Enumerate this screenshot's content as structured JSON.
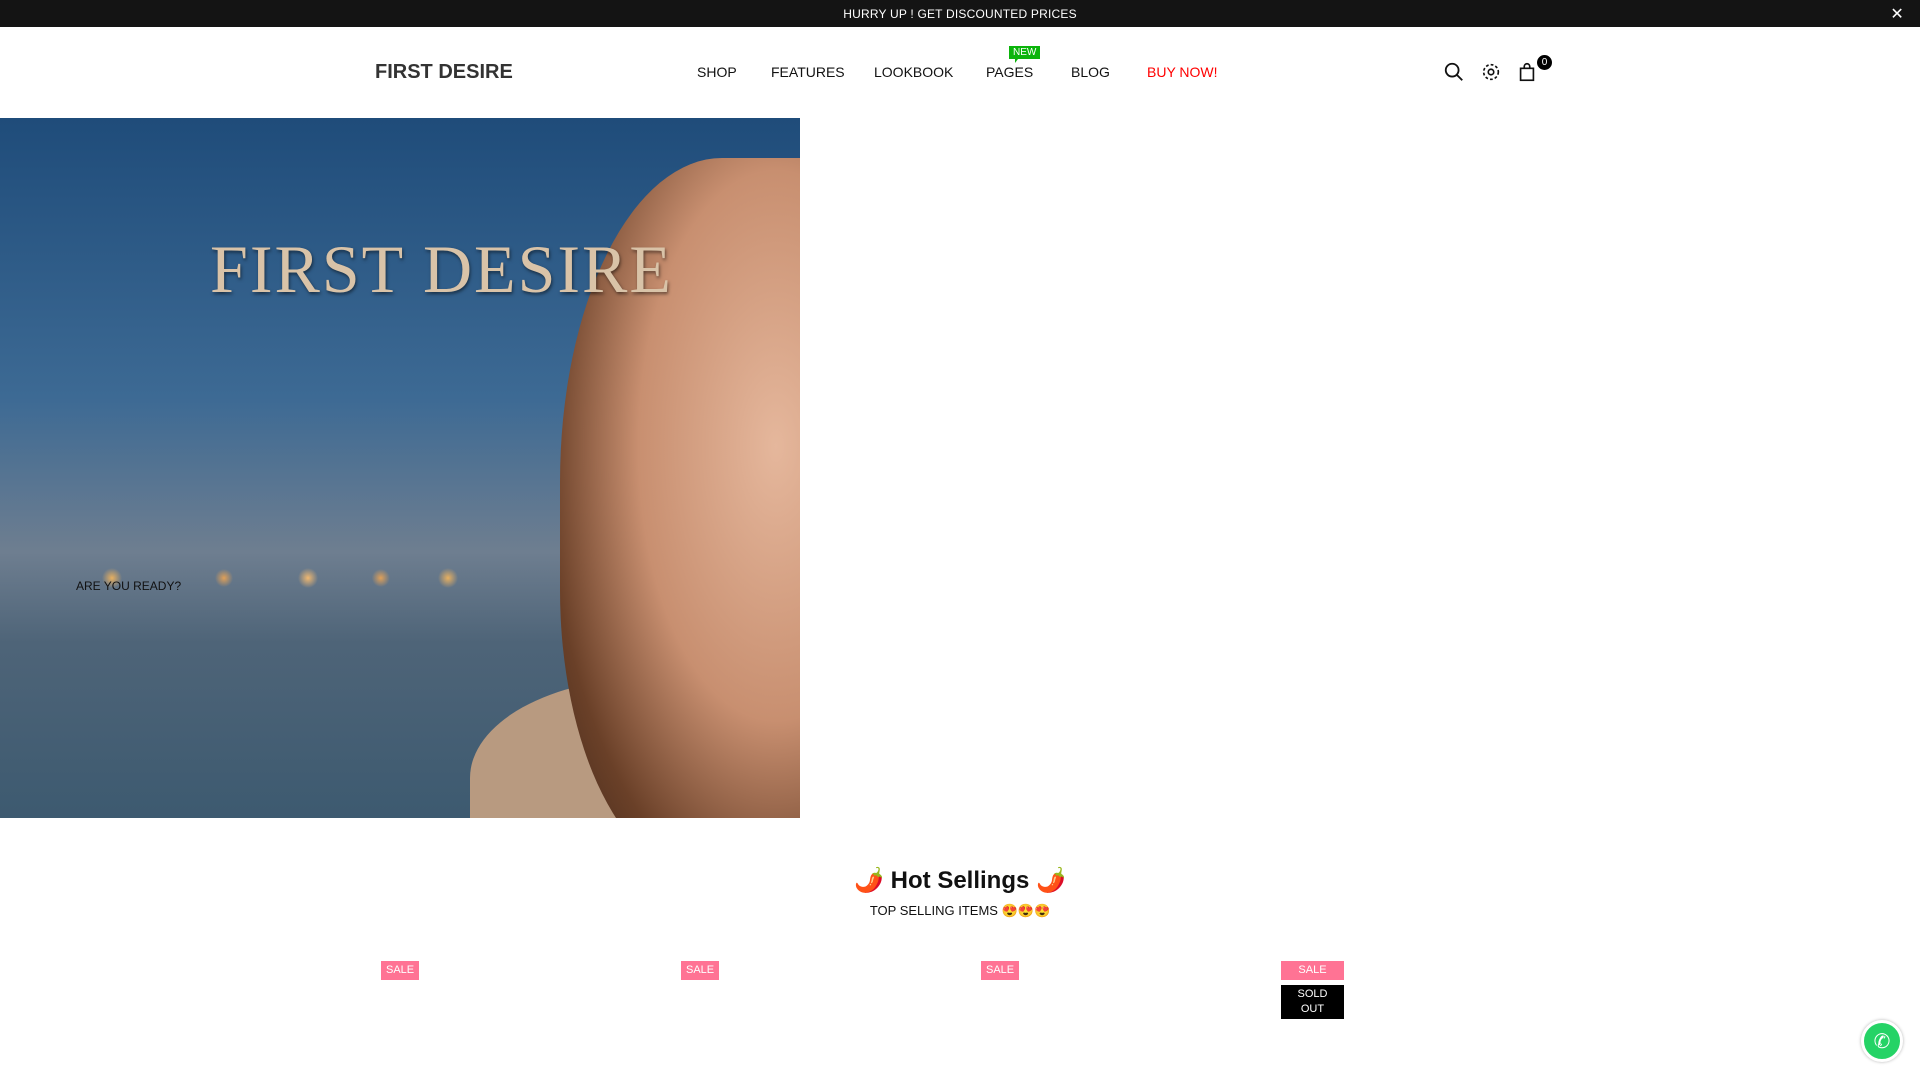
{
  "announcement": {
    "text": "HURRY UP ! GET DISCOUNTED PRICES",
    "close": "✕"
  },
  "header": {
    "logo": "FIRST DESIRE",
    "nav": [
      {
        "label": "SHOP"
      },
      {
        "label": "FEATURES"
      },
      {
        "label": "LOOKBOOK"
      },
      {
        "label": "PAGES",
        "badge": "NEW"
      },
      {
        "label": "BLOG"
      },
      {
        "label": "BUY NOW!"
      }
    ],
    "cart_count": "0"
  },
  "hero": {
    "logo_text": "FIRST DESIRE",
    "tagline": "ARE YOU READY?"
  },
  "section": {
    "title": "🌶️ Hot Sellings 🌶️",
    "subtitle": "TOP SELLING ITEMS 😍😍😍"
  },
  "products": [
    {
      "badges": [
        "SALE"
      ]
    },
    {
      "badges": [
        "SALE"
      ]
    },
    {
      "badges": [
        "SALE"
      ]
    },
    {
      "badges": [
        "SALE",
        "SOLD OUT"
      ]
    }
  ],
  "colors": {
    "accent": "#ff0000",
    "sale": "#ff7394",
    "new": "#0bb40b"
  }
}
